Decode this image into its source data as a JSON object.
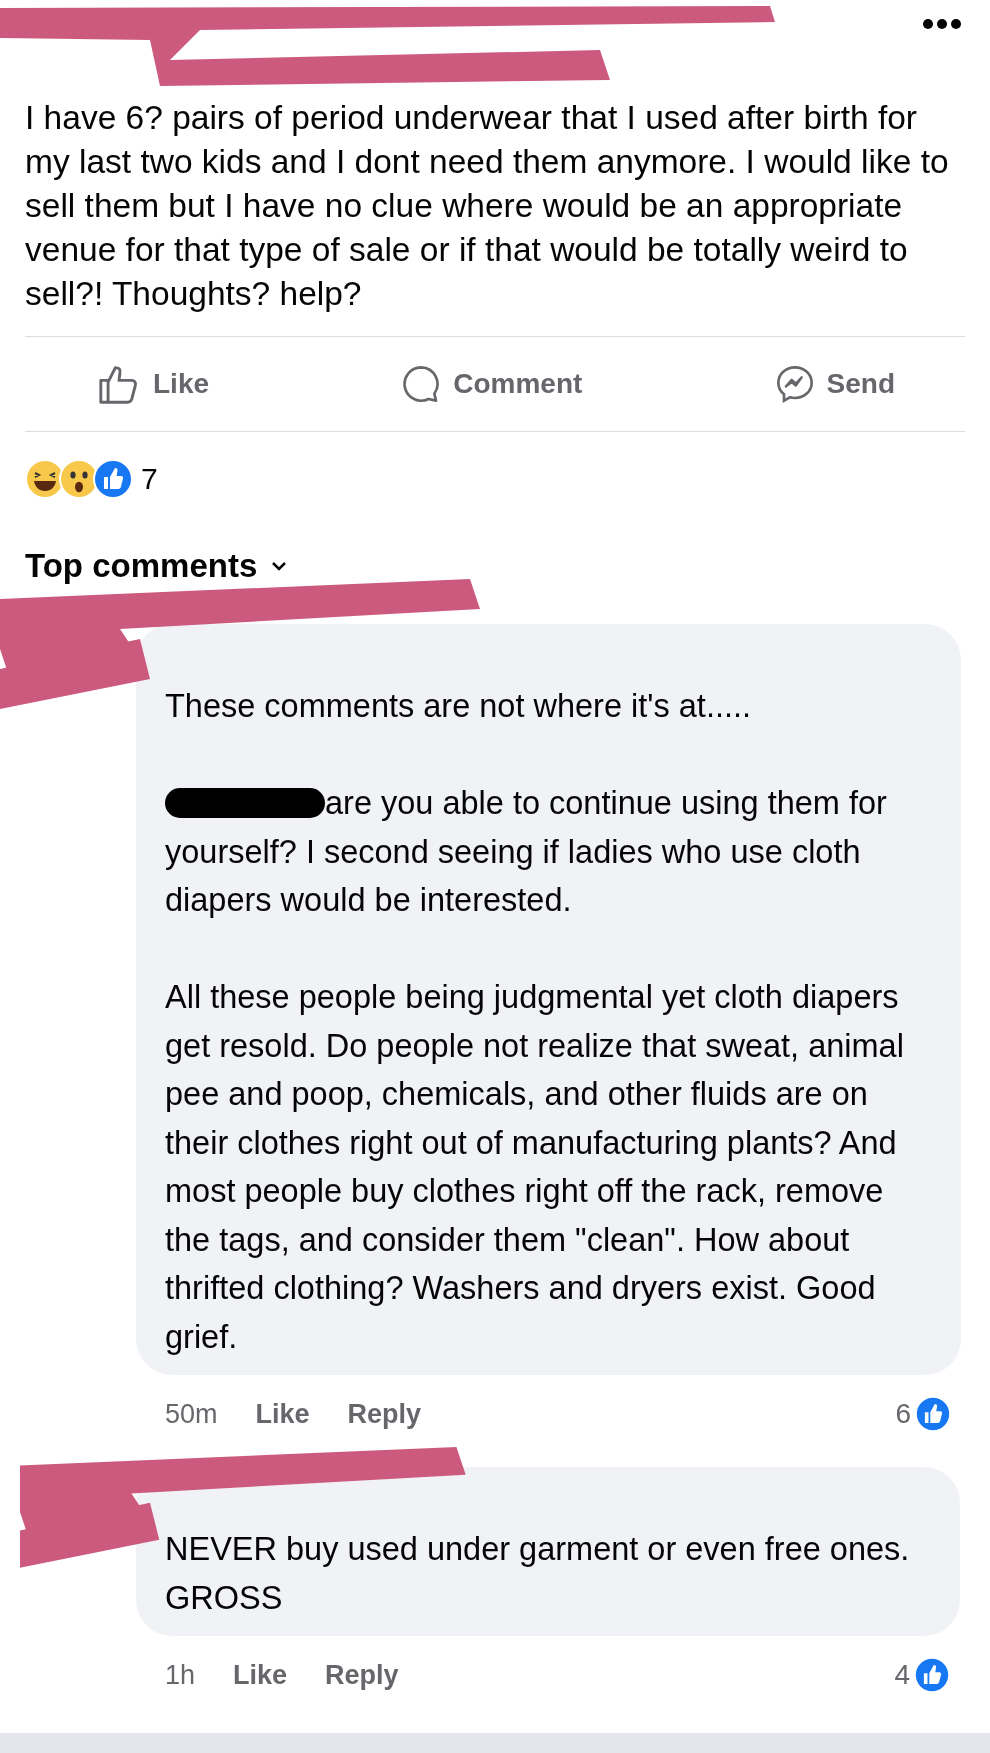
{
  "post": {
    "text": "I have 6? pairs of period underwear that I used after birth for my last two kids and I dont need them anymore. I would like to sell them but I have no clue where would be an appropriate venue for that type of sale or if that would be totally weird to sell?! Thoughts? help?",
    "actions": [
      {
        "kind": "like",
        "label": "Like"
      },
      {
        "kind": "comment",
        "label": "Comment"
      },
      {
        "kind": "send",
        "label": "Send"
      }
    ],
    "reaction_count": "7"
  },
  "comments_header": {
    "label": "Top comments"
  },
  "comments": [
    {
      "paragraphs": [
        {
          "text": "These comments are not where it's at.....",
          "redacted_prefix": false
        },
        {
          "text": "are you able to continue using them for yourself? I second seeing if ladies who use cloth diapers would be interested.",
          "redacted_prefix": true
        },
        {
          "text": "All these people being judgmental yet cloth diapers get resold. Do people not realize that sweat, animal pee and poop, chemicals, and other fluids are on their clothes right out of manufacturing plants? And most people buy clothes right off the rack, remove the tags, and consider them \"clean\". How about thrifted clothing? Washers and dryers exist. Good grief.",
          "redacted_prefix": false
        }
      ],
      "time": "50m",
      "like": "Like",
      "reply": "Reply",
      "likes": "6"
    },
    {
      "paragraphs": [
        {
          "text": "NEVER buy used under garment or even free ones. GROSS",
          "redacted_prefix": false
        }
      ],
      "time": "1h",
      "like": "Like",
      "reply": "Reply",
      "likes": "4"
    }
  ]
}
